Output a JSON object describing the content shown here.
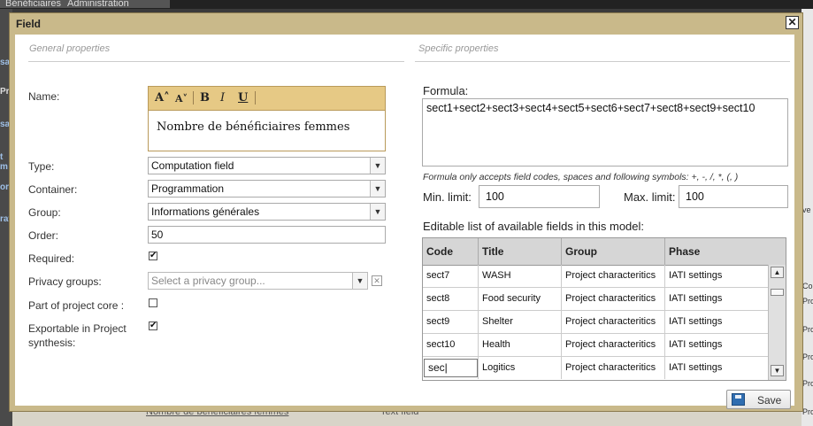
{
  "background": {
    "tabs": [
      "Bénéficiaires",
      "Administration"
    ],
    "left_labels": [
      "sa",
      "Pr",
      "sa",
      "t m",
      "ori",
      "rat"
    ],
    "right_labels": [
      "ve",
      "Co",
      "Pro",
      "Pro",
      "Pro",
      "Pro",
      "Pro"
    ],
    "bottom_link": "Nombre de bénéficiaires femmes",
    "bottom_text": "Text field"
  },
  "dialog": {
    "title": "Field",
    "close_label": "✕",
    "general_title": "General properties",
    "specific_title": "Specific properties"
  },
  "general": {
    "name_label": "Name:",
    "editor_toolbar": [
      "A˄",
      "A˅",
      "B",
      "I",
      "U"
    ],
    "name_value": "Nombre de bénéficiaires femmes",
    "type_label": "Type:",
    "type_value": "Computation field",
    "container_label": "Container:",
    "container_value": "Programmation",
    "group_label": "Group:",
    "group_value": "Informations générales",
    "order_label": "Order:",
    "order_value": "50",
    "required_label": "Required:",
    "required_checked": "✔",
    "privacy_label": "Privacy groups:",
    "privacy_placeholder": "Select a privacy group...",
    "core_label": "Part of project core :",
    "core_checked": "",
    "exportable_label_1": "Exportable in Project",
    "exportable_label_2": "synthesis:",
    "exportable_checked": "✔"
  },
  "specific": {
    "formula_label": "Formula:",
    "formula_value": "sect1+sect2+sect3+sect4+sect5+sect6+sect7+sect8+sect9+sect10",
    "hint": "Formula only accepts field codes, spaces and following symbols: +, -, /, *, (, )",
    "min_label": "Min. limit:",
    "min_value": "100",
    "max_label": "Max. limit:",
    "max_value": "100",
    "grid_label": "Editable list of available fields in this model:",
    "columns": [
      "Code",
      "Title",
      "Group",
      "Phase"
    ],
    "rows": [
      {
        "code": "sect7",
        "title": "WASH",
        "group": "Project characteritics",
        "phase": "IATI settings"
      },
      {
        "code": "sect8",
        "title": "Food security",
        "group": "Project characteritics",
        "phase": "IATI settings"
      },
      {
        "code": "sect9",
        "title": "Shelter",
        "group": "Project characteritics",
        "phase": "IATI settings"
      },
      {
        "code": "sect10",
        "title": "Health",
        "group": "Project characteritics",
        "phase": "IATI settings"
      },
      {
        "code": "sec|",
        "title": "Logitics",
        "group": "Project characteritics",
        "phase": "IATI settings"
      }
    ],
    "save_label": "Save"
  }
}
